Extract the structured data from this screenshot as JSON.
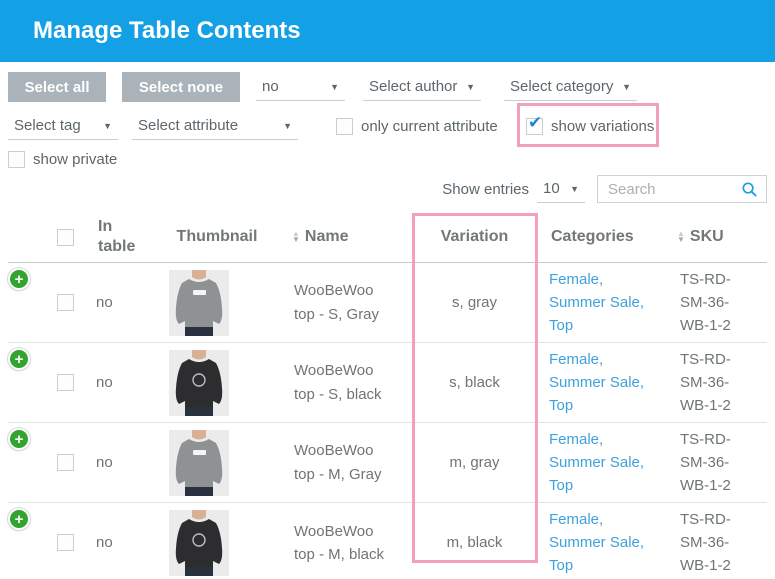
{
  "page": {
    "title": "Manage Table Contents"
  },
  "toolbar": {
    "select_all_label": "Select all",
    "select_none_label": "Select none",
    "in_table_dropdown": {
      "value": "no"
    },
    "author_dropdown": {
      "label": "Select author"
    },
    "category_dropdown": {
      "label": "Select category"
    },
    "tag_dropdown": {
      "label": "Select tag"
    },
    "attribute_dropdown": {
      "label": "Select attribute"
    },
    "only_current_attribute": {
      "label": "only current attribute",
      "checked": false
    },
    "show_variations": {
      "label": "show variations",
      "checked": true
    },
    "show_private": {
      "label": "show private",
      "checked": false
    }
  },
  "list_controls": {
    "show_entries_label": "Show entries",
    "entries_per_page": "10",
    "search_placeholder": "Search"
  },
  "table": {
    "headers": {
      "in_table": "In table",
      "thumbnail": "Thumbnail",
      "name": "Name",
      "variation": "Variation",
      "categories": "Categories",
      "sku": "SKU"
    },
    "rows": [
      {
        "in_table": "no",
        "thumbnail": "gray-sweatshirt",
        "name": "WooBeWoo top - S, Gray",
        "variation": "s, gray",
        "categories": [
          "Female",
          "Summer Sale",
          "Top"
        ],
        "sku": "TS-RD-SM-36-WB-1-2"
      },
      {
        "in_table": "no",
        "thumbnail": "black-sweatshirt",
        "name": "WooBeWoo top - S, black",
        "variation": "s, black",
        "categories": [
          "Female",
          "Summer Sale",
          "Top"
        ],
        "sku": "TS-RD-SM-36-WB-1-2"
      },
      {
        "in_table": "no",
        "thumbnail": "gray-sweatshirt",
        "name": "WooBeWoo top - M, Gray",
        "variation": "m, gray",
        "categories": [
          "Female",
          "Summer Sale",
          "Top"
        ],
        "sku": "TS-RD-SM-36-WB-1-2"
      },
      {
        "in_table": "no",
        "thumbnail": "black-sweatshirt",
        "name": "WooBeWoo top - M, black",
        "variation": "m, black",
        "categories": [
          "Female",
          "Summer Sale",
          "Top"
        ],
        "sku": "TS-RD-SM-36-WB-1-2"
      }
    ]
  },
  "icons": {
    "dropdown_arrow": "▼",
    "checkmark": "✔",
    "add_plus": "+",
    "sort_ascending": "▲",
    "sort_descending": "▼",
    "search": "magnifying-glass"
  },
  "colors": {
    "header_blue": "#14a0e5",
    "accent_blue": "#1b9fe0",
    "link_blue": "#3fa1dc",
    "check_blue": "#1f87c9",
    "button_gray": "#a9b3b9",
    "highlight_pink": "#f3a0ba",
    "add_green": "#31a42c"
  }
}
